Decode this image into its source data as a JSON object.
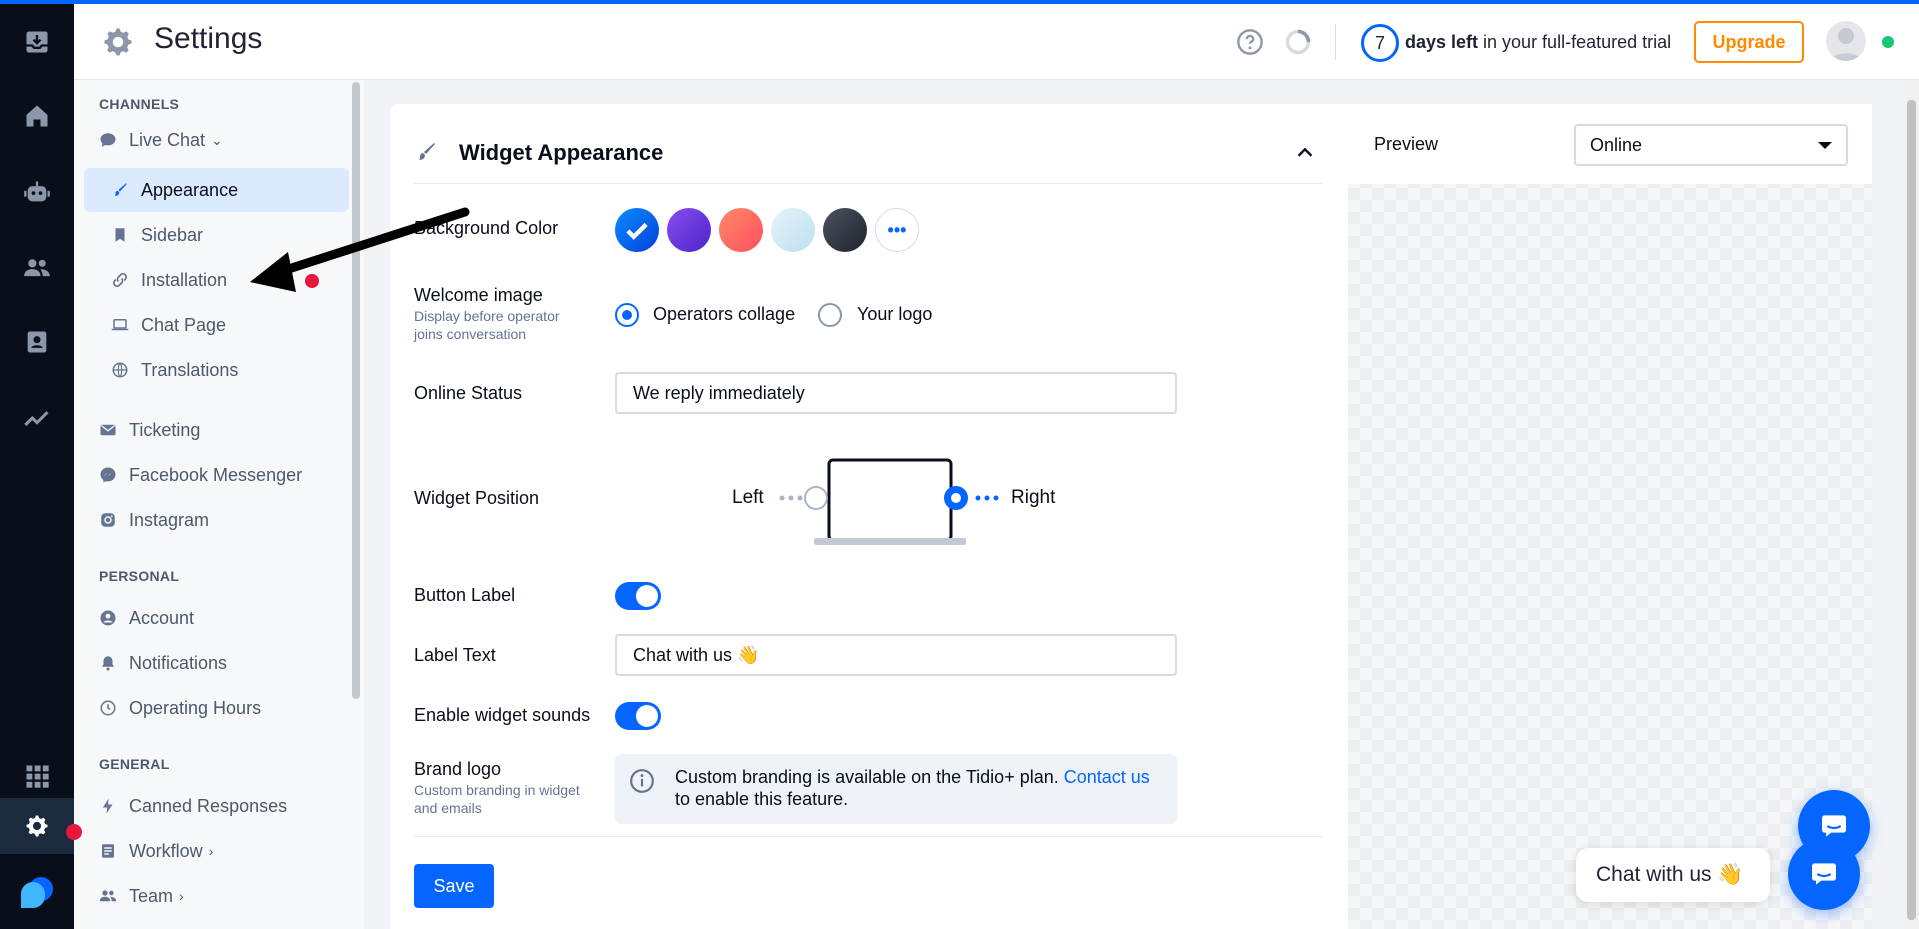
{
  "header": {
    "title": "Settings",
    "trial_days": "7",
    "trial_bold": "days left",
    "trial_rest": " in your full-featured trial",
    "upgrade_label": "Upgrade"
  },
  "sidebar": {
    "channels_title": "CHANNELS",
    "live_chat": "Live Chat",
    "live_chat_items": [
      {
        "label": "Appearance",
        "icon": "brush-icon"
      },
      {
        "label": "Sidebar",
        "icon": "bookmark-icon"
      },
      {
        "label": "Installation",
        "icon": "link-icon"
      },
      {
        "label": "Chat Page",
        "icon": "laptop-icon"
      },
      {
        "label": "Translations",
        "icon": "globe-icon"
      }
    ],
    "channel_items": [
      {
        "label": "Ticketing",
        "icon": "mail-icon"
      },
      {
        "label": "Facebook Messenger",
        "icon": "messenger-icon"
      },
      {
        "label": "Instagram",
        "icon": "instagram-icon"
      }
    ],
    "personal_title": "PERSONAL",
    "personal_items": [
      {
        "label": "Account",
        "icon": "user-icon"
      },
      {
        "label": "Notifications",
        "icon": "bell-icon"
      },
      {
        "label": "Operating Hours",
        "icon": "clock-icon"
      }
    ],
    "general_title": "GENERAL",
    "general_items": [
      {
        "label": "Canned Responses",
        "icon": "bolt-icon"
      },
      {
        "label": "Workflow",
        "icon": "workflow-icon"
      },
      {
        "label": "Team",
        "icon": "team-icon"
      }
    ]
  },
  "widget": {
    "title": "Widget Appearance",
    "background_color_label": "Background Color",
    "colors": [
      "#0566ff",
      "#6c3fe0",
      "#ff5f5f",
      "#cfe8f5",
      "#2f3640"
    ],
    "welcome_image_label": "Welcome image",
    "welcome_image_hint": "Display before operator joins conversation",
    "welcome_options": [
      "Operators collage",
      "Your logo"
    ],
    "online_status_label": "Online Status",
    "online_status_value": "We reply immediately",
    "widget_position_label": "Widget Position",
    "position_left": "Left",
    "position_right": "Right",
    "button_label_label": "Button Label",
    "label_text_label": "Label Text",
    "label_text_value": "Chat with us 👋",
    "sounds_label": "Enable widget sounds",
    "brand_logo_label": "Brand logo",
    "brand_logo_hint": "Custom branding in widget and emails",
    "branding_info": "Custom branding is available on the Tidio+ plan. ",
    "branding_link": "Contact us",
    "branding_info_end": " to enable this feature.",
    "save_label": "Save"
  },
  "preview": {
    "label": "Preview",
    "select_value": "Online",
    "bubble_text": "Chat with us 👋"
  }
}
